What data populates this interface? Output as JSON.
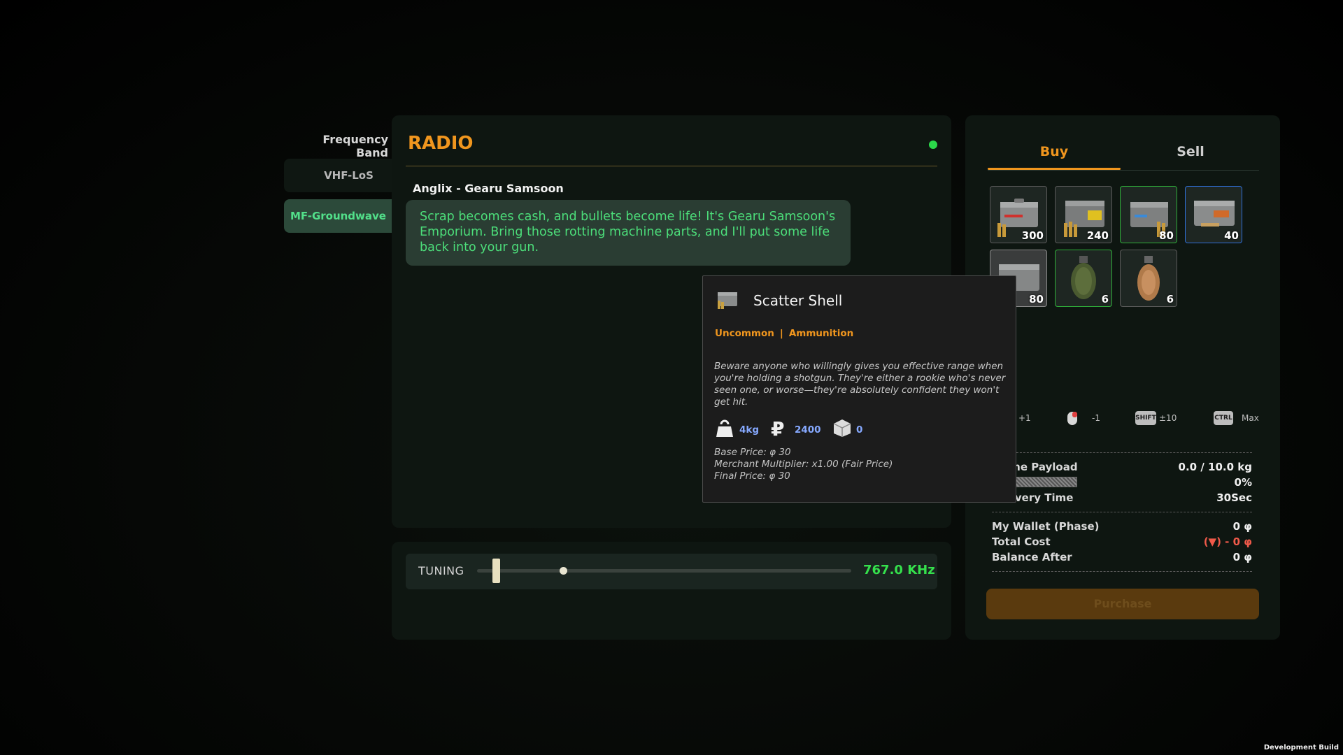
{
  "frequency_band": {
    "title": "Frequency Band",
    "items": [
      {
        "label": "VHF-LoS",
        "active": false
      },
      {
        "label": "MF-Groundwave",
        "active": true
      }
    ]
  },
  "radio": {
    "title": "RADIO",
    "status_color": "#2bd84a",
    "speaker": "Anglix - Gearu Samsoon",
    "message": "Scrap becomes cash, and bullets become life! It's Gearu Samsoon's Emporium. Bring those rotting machine parts, and I'll put some life back into your gun."
  },
  "tuning": {
    "label": "TUNING",
    "value": "767.0 KHz",
    "handle_position": 0.05,
    "signal_position": 0.23
  },
  "trade": {
    "tabs": [
      {
        "label": "Buy",
        "active": true
      },
      {
        "label": "Sell",
        "active": false
      }
    ],
    "items": [
      {
        "icon": "ammo-crate-red-icon",
        "count": "300",
        "border": "#5a5a5a"
      },
      {
        "icon": "ammo-crate-yellow-icon",
        "count": "240",
        "border": "#5a5a5a"
      },
      {
        "icon": "ammo-crate-green-icon",
        "count": "80",
        "border": "#2fae3a"
      },
      {
        "icon": "ammo-crate-blue-icon",
        "count": "40",
        "border": "#2f6fd8"
      },
      {
        "icon": "scatter-shell-crate-icon",
        "count": "80",
        "border": "#8a8a8a"
      },
      {
        "icon": "frag-grenade-icon",
        "count": "6",
        "border": "#2fae3a"
      },
      {
        "icon": "incendiary-grenade-icon",
        "count": "6",
        "border": "#5a5a5a"
      }
    ],
    "controls": [
      {
        "icon": "mouse-left-icon",
        "label": "+1"
      },
      {
        "icon": "mouse-right-icon",
        "label": "-1"
      },
      {
        "key": "SHIFT",
        "label": "±10"
      },
      {
        "key": "CTRL",
        "label": "Max"
      }
    ],
    "drone_payload": {
      "label": "Drone Payload",
      "value": "0.0 / 10.0 kg",
      "percent": "0%"
    },
    "delivery_time": {
      "label": "Delivery Time",
      "value": "30Sec"
    },
    "wallet": {
      "label": "My Wallet (Phase)",
      "value": "0 φ"
    },
    "total_cost": {
      "label": "Total Cost",
      "value": "(▼) - 0 φ"
    },
    "balance_after": {
      "label": "Balance After",
      "value": "0 φ"
    },
    "purchase_label": "Purchase"
  },
  "tooltip": {
    "name": "Scatter Shell",
    "rarity": "Uncommon",
    "category": "Ammunition",
    "description": "Beware anyone who willingly gives you effective range when you're holding a shotgun. They're either a rookie who's never seen one, or worse—they're absolutely confident they won't get hit.",
    "weight": "4kg",
    "ruble_value": "2400",
    "stack_value": "0",
    "base_price": "Base Price: φ 30",
    "merchant_multiplier": "Merchant Multiplier: x1.00 (Fair Price)",
    "final_price": "Final Price: φ 30"
  },
  "build_label": "Development Build"
}
